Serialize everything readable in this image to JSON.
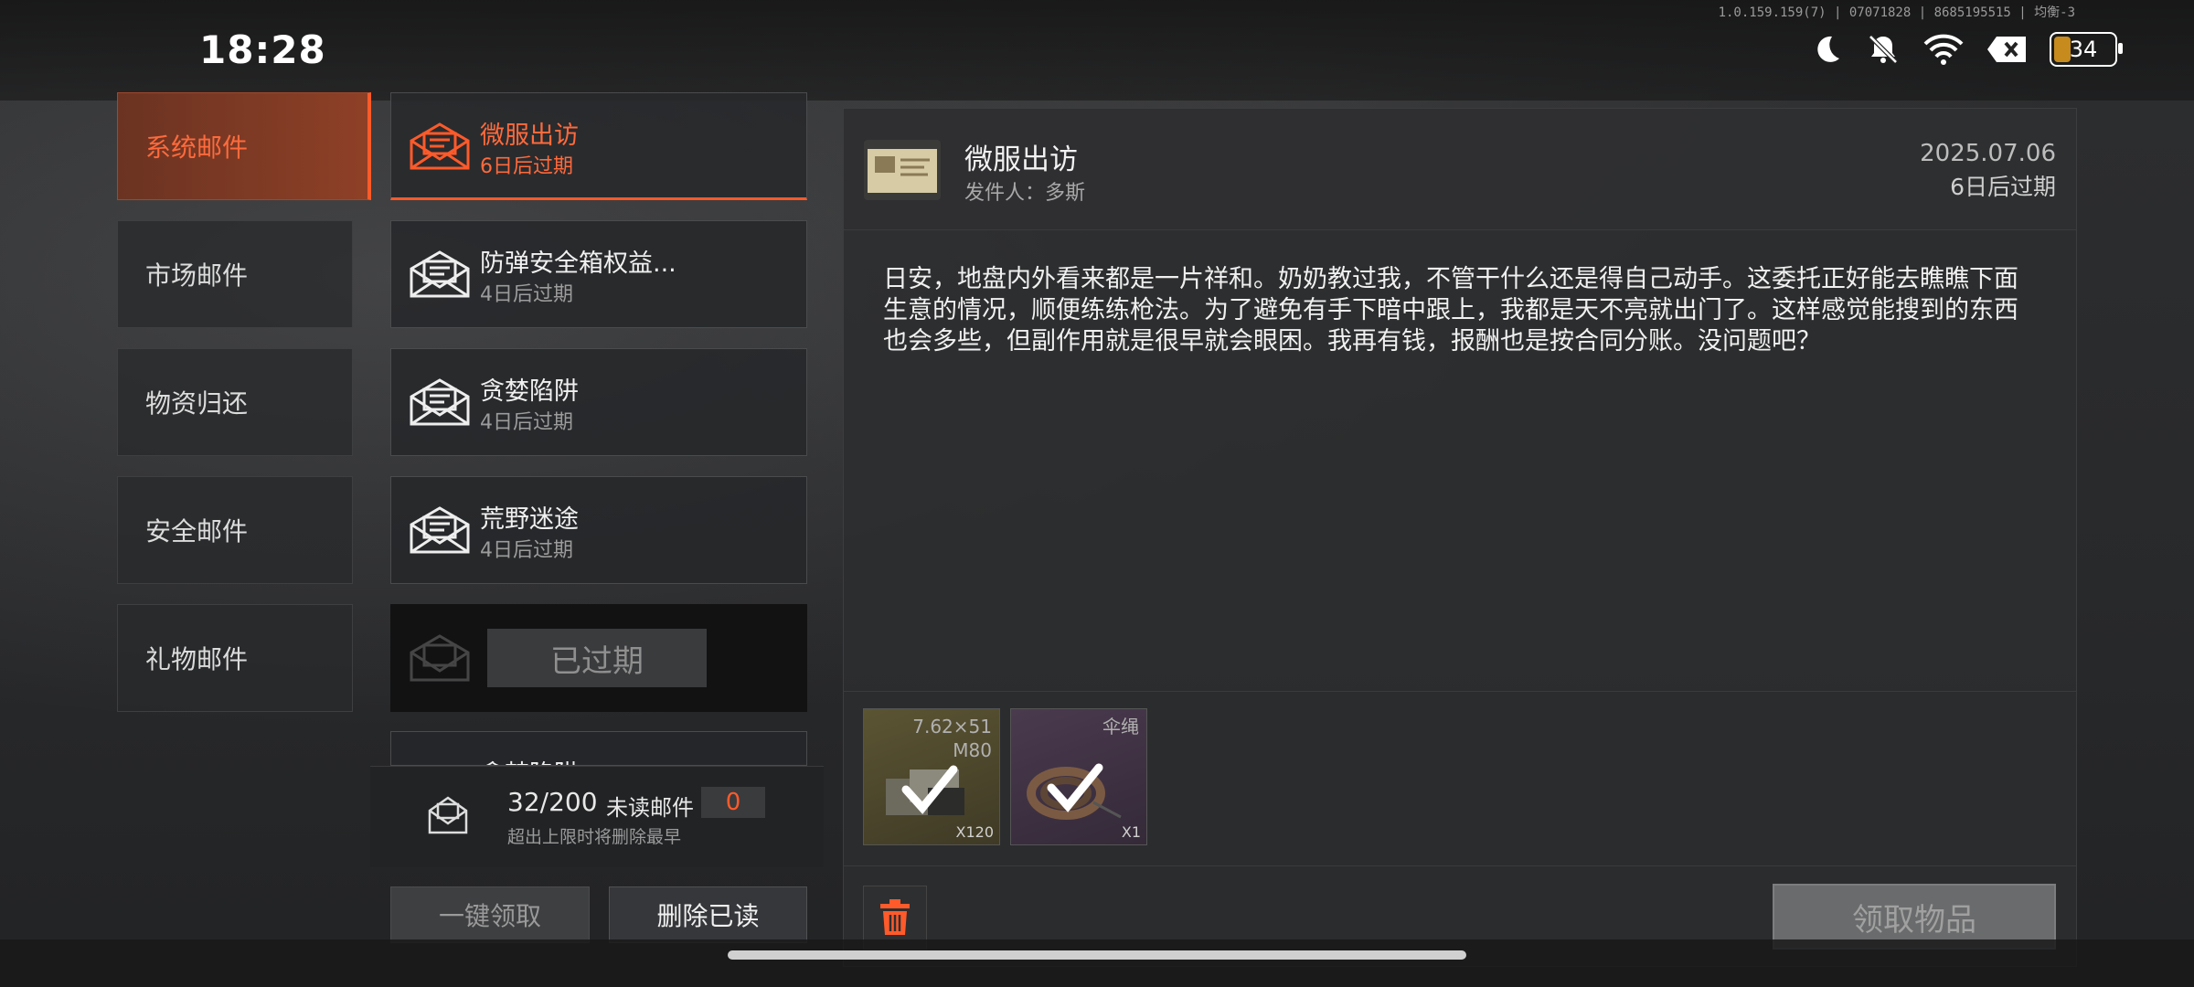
{
  "status_bar": {
    "time": "18:28",
    "version": "1.0.159.159(7) | 07071828 | 8685195515 | 均衡-3",
    "battery": "34"
  },
  "categories": [
    {
      "label": "系统邮件",
      "active": true
    },
    {
      "label": "市场邮件",
      "active": false
    },
    {
      "label": "物资归还",
      "active": false
    },
    {
      "label": "安全邮件",
      "active": false
    },
    {
      "label": "礼物邮件",
      "active": false
    }
  ],
  "mails": [
    {
      "subject": "微服出访",
      "expiry": "6日后过期"
    },
    {
      "subject": "防弹安全箱权益...",
      "expiry": "4日后过期"
    },
    {
      "subject": "贪婪陷阱",
      "expiry": "4日后过期"
    },
    {
      "subject": "荒野迷途",
      "expiry": "4日后过期"
    },
    {
      "expired_label": "已过期"
    },
    {
      "subject": "贪婪陷阱"
    }
  ],
  "list_footer": {
    "count": "32/200",
    "unread_label": "未读邮件",
    "unread_count": "0",
    "limit_note": "超出上限时将删除最早",
    "claim_all": "一键领取",
    "delete_read": "删除已读"
  },
  "detail": {
    "title": "微服出访",
    "sender": "发件人：多斯",
    "date": "2025.07.06",
    "expiry": "6日后过期",
    "body": "日安，地盘内外看来都是一片祥和。奶奶教过我，不管干什么还是得自己动手。这委托正好能去瞧瞧下面生意的情况，顺便练练枪法。为了避免有手下暗中跟上，我都是天不亮就出门了。这样感觉能搜到的东西也会多些，但副作用就是很早就会眼困。我再有钱，报酬也是按合同分账。没问题吧？",
    "attachments": [
      {
        "name_line1": "7.62×51",
        "name_line2": "M80",
        "qty": "X120"
      },
      {
        "name_line1": "伞绳",
        "qty": "X1"
      }
    ],
    "claim_label": "领取物品"
  },
  "colors": {
    "accent": "#ff5a2a"
  }
}
